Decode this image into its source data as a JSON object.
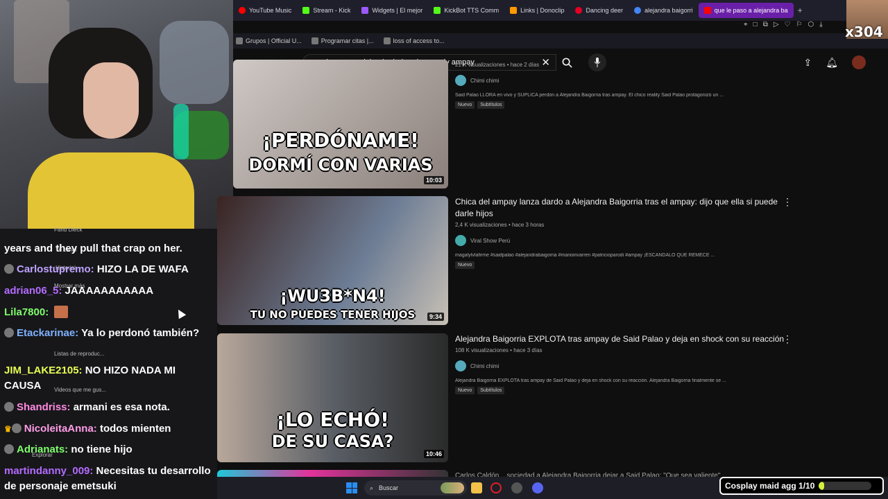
{
  "browser": {
    "tabs": [
      {
        "label": "YouTube Music",
        "color": "#ff0000"
      },
      {
        "label": "Stream - Kick",
        "color": "#53fc18"
      },
      {
        "label": "Widgets | El mejor",
        "color": "#9b59ff"
      },
      {
        "label": "KickBot TTS Comm",
        "color": "#53fc18"
      },
      {
        "label": "Links | Donoclip",
        "color": "#ff9900"
      },
      {
        "label": "Dancing deer",
        "color": "#e60023"
      },
      {
        "label": "alejandra baigorri",
        "color": "#4285f4"
      },
      {
        "label": "que le paso a alejandra ba",
        "color": "#ff0000",
        "active": true
      }
    ],
    "new_tab": "+",
    "bookmarks": [
      "Grupos | Official U...",
      "Programar citas |...",
      "loss of access to..."
    ]
  },
  "youtube": {
    "search": {
      "value": "que le paso a alejandra balgorria magaly ampay",
      "clear": "✕",
      "search_icon": "⌕",
      "mic_icon": "🎙"
    },
    "results": [
      {
        "thumb_caption_1": "¡PERDÓNAME!",
        "thumb_caption_2": "DORMÍ CON VARIAS",
        "duration": "10:03",
        "title": "",
        "views": "21 K visualizaciones",
        "age": "hace 2 días",
        "channel": "Chimi chimi",
        "description": "Said Palao LLORA en vivo y SUPLICA perdón a Alejandra Baigorria tras ampay. El chico reality Said Palao protagonizó un ...",
        "badges": [
          "Nuevo",
          "Subtítulos"
        ]
      },
      {
        "thumb_caption_1": "¡WU3B*N4!",
        "thumb_caption_2": "TU NO PUEDES TENER HIJOS",
        "duration": "9:34",
        "title": "Chica del ampay lanza dardo a Alejandra Baigorria tras el ampay: dijo que ella si puede darle hijos",
        "views": "2,4 K visualizaciones",
        "age": "hace 3 horas",
        "channel": "Viral Show Perú",
        "description": "magalytvlafirme #saidpalao #alejandrabaigorria #marioirivarren #patricioparodi #ampay ¡ESCÁNDALO QUE REMECE ...",
        "badges": [
          "Nuevo"
        ]
      },
      {
        "thumb_caption_1": "¡LO ECHÓ!",
        "thumb_caption_2": "DE SU CASA?",
        "duration": "10:46",
        "title": "Alejandra Baigorria EXPLOTA tras ampay de Said Palao y deja en shock con su reacción",
        "views": "108 K visualizaciones",
        "age": "hace 3 días",
        "channel": "Chimi chimi",
        "description": "Alejandra Baigorria EXPLOTA tras ampay de Said Palao y deja en shock con su reacción. Alejandra Baigorria finalmente se ...",
        "badges": [
          "Nuevo",
          "Subtítulos"
        ]
      }
    ],
    "peek_title": "Carlos Caldón ...sociedad a Alejandra Baigorria dejar a Said Palao: \"Que sea valiente\""
  },
  "chat": [
    {
      "user": "",
      "text": "years and they pull that crap on her.",
      "color": "#ffffff",
      "badge": false
    },
    {
      "user": "Carlostupremo:",
      "text": " HIZO LA DE WAFA",
      "color": "#bfa3ff",
      "badge": true
    },
    {
      "user": "adrian06_5:",
      "text": " JAAAAAAAAAAA",
      "color": "#b46bff",
      "badge": false
    },
    {
      "user": "Lila7800:",
      "text": "",
      "color": "#7fff6b",
      "badge": false
    },
    {
      "user": "Etackarinae:",
      "text": " Ya lo perdonó también?",
      "color": "#7fb2ff",
      "badge": true
    },
    {
      "user": "JIM_LAKE2105:",
      "text": " NO HIZO NADA MI CAUSA",
      "color": "#e8ff52",
      "badge": false
    },
    {
      "user": "Shandriss:",
      "text": " armani es esa nota.",
      "color": "#ff8ae0",
      "badge": true
    },
    {
      "user": "NicoleitaAnna:",
      "text": " todos mienten",
      "color": "#ff9ee8",
      "badge": true
    },
    {
      "user": "Adrianats:",
      "text": " no tiene hijo",
      "color": "#7fff6b",
      "badge": true
    },
    {
      "user": "martindanny_009:",
      "text": " Necesitas tu desarrollo de personaje emetsuki",
      "color": "#b46bff",
      "badge": false
    }
  ],
  "ghost_menu": [
    "Farid Dieck",
    "Tu canal",
    "Historial",
    "Mostrar más",
    "Listas de reproduc...",
    "Videos que me gus...",
    "Explorar"
  ],
  "taskbar": {
    "search_label": "Buscar"
  },
  "goal": {
    "label": "Cosplay maid agg 1/10",
    "progress": 0.1
  },
  "overlay": {
    "counter": "x304"
  }
}
